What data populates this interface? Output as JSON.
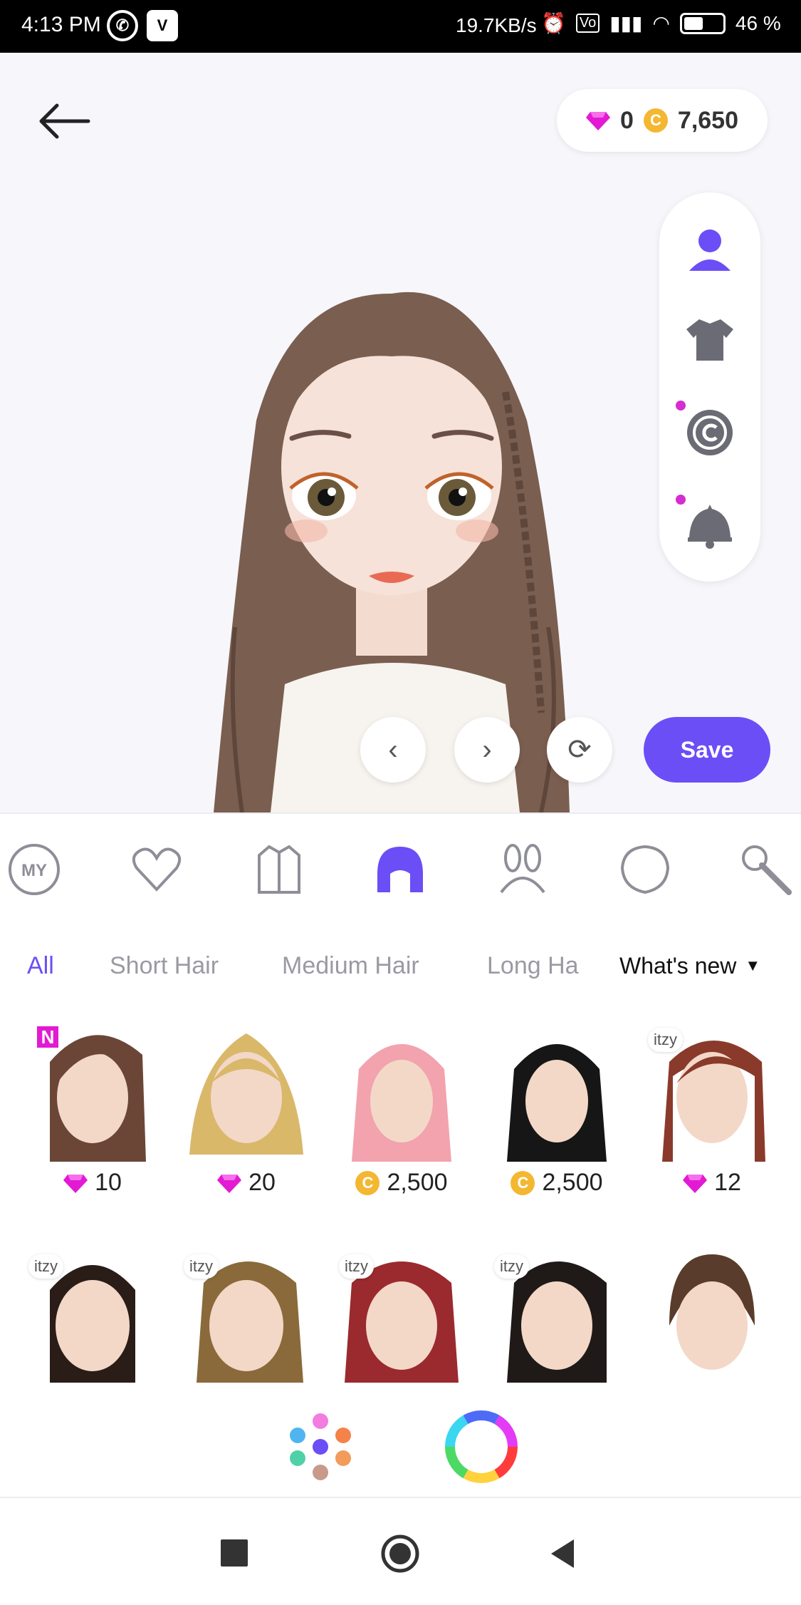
{
  "status_bar": {
    "time": "4:13 PM",
    "app_icons": [
      "whatsapp-icon",
      "v-app-icon"
    ],
    "v_label": "V",
    "network_speed": "19.7KB/s",
    "battery": "46 %"
  },
  "header": {
    "diamonds": "0",
    "coins": "7,650",
    "coin_glyph": "C"
  },
  "side_menu": {
    "items": [
      "avatar-icon",
      "shirt-icon",
      "copyright-icon",
      "bell-icon"
    ]
  },
  "controls": {
    "save_label": "Save"
  },
  "categories": [
    "my-icon",
    "heart-icon",
    "jacket-icon",
    "hair-icon",
    "bunny-ears-icon",
    "face-shape-icon",
    "makeup-brush-icon"
  ],
  "category_my_label": "MY",
  "filters": {
    "tabs": [
      "All",
      "Short Hair",
      "Medium Hair",
      "Long Ha"
    ],
    "sort_label": "What's new"
  },
  "items_row1": [
    {
      "price": "10",
      "currency": "diamond",
      "badge": "N",
      "hair_color": "#6b4636"
    },
    {
      "price": "20",
      "currency": "diamond",
      "badge": "",
      "hair_color": "#d9b86a"
    },
    {
      "price": "2,500",
      "currency": "coin",
      "badge": "",
      "hair_color": "#f2a3ad"
    },
    {
      "price": "2,500",
      "currency": "coin",
      "badge": "",
      "hair_color": "#161616"
    },
    {
      "price": "12",
      "currency": "diamond",
      "badge": "itzy",
      "hair_color": "#8a3a2a"
    }
  ],
  "items_row2": [
    {
      "badge": "itzy",
      "hair_color": "#2a1c17"
    },
    {
      "badge": "itzy",
      "hair_color": "#8a6a3a"
    },
    {
      "badge": "itzy",
      "hair_color": "#9a2a2e"
    },
    {
      "badge": "itzy",
      "hair_color": "#1f1a18"
    },
    {
      "badge": "",
      "hair_color": "#5a3c2c"
    }
  ],
  "colors": {
    "accent": "#6b4ef6",
    "diamond": "#e21ad4",
    "coin": "#f4b731"
  }
}
